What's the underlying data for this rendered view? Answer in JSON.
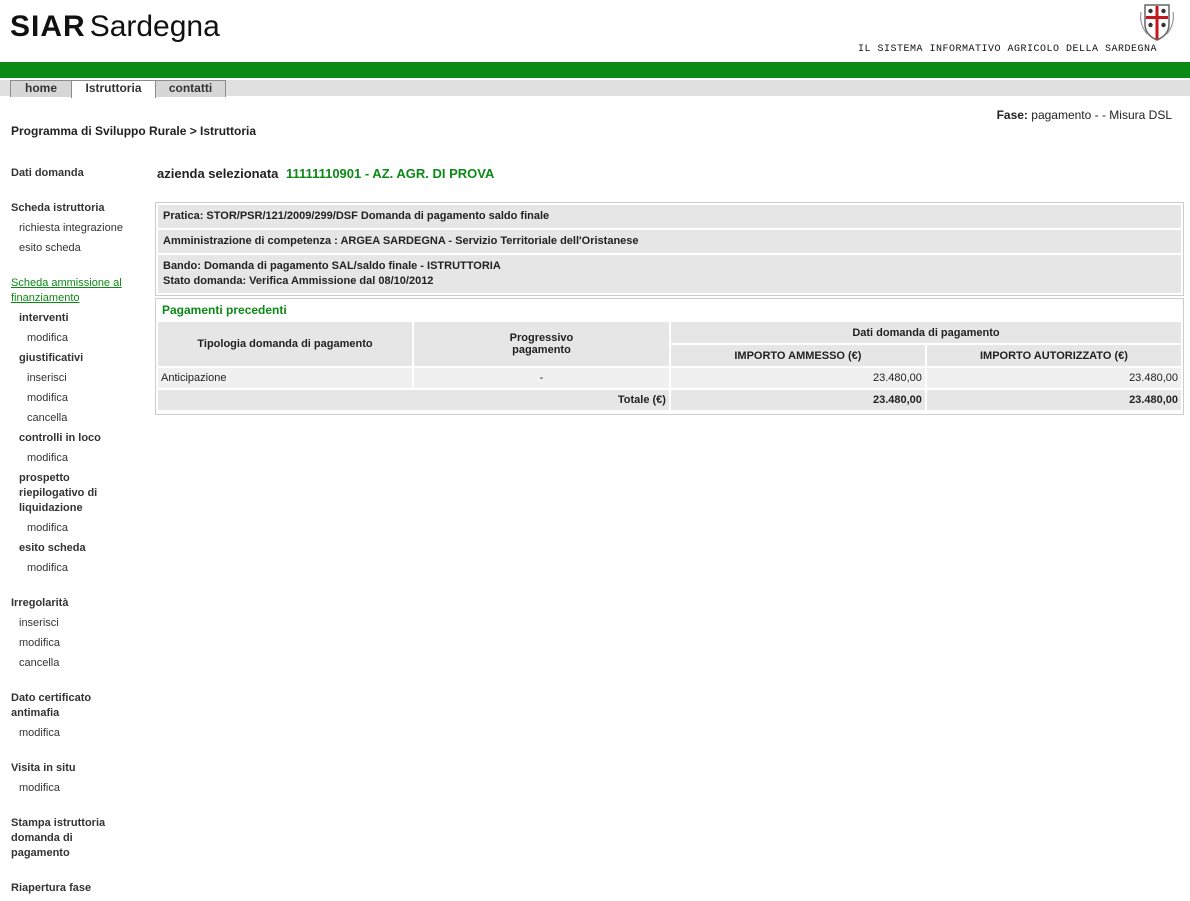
{
  "header": {
    "logo_bold": "SIAR",
    "logo_light": "Sardegna",
    "emblem": "regione-sardegna-coat-of-arms-icon",
    "tagline": "IL SISTEMA INFORMATIVO AGRICOLO DELLA SARDEGNA"
  },
  "colors": {
    "brand_green": "#0b8a16",
    "panel_grey": "#e6e6e6"
  },
  "tabs": [
    {
      "label": "home"
    },
    {
      "label": "Istruttoria",
      "active": true
    },
    {
      "label": "contatti"
    }
  ],
  "fase": {
    "label": "Fase:",
    "value": "pagamento - - Misura DSL"
  },
  "breadcrumb": "Programma di Sviluppo Rurale > Istruttoria",
  "sidebar": {
    "items": [
      {
        "label": "Dati domanda"
      },
      {
        "label": "Scheda istruttoria"
      },
      {
        "label": "richiesta integrazione"
      },
      {
        "label": "esito scheda"
      },
      {
        "label": "Scheda ammissione al finanziamento"
      },
      {
        "label": "interventi"
      },
      {
        "label": "modifica"
      },
      {
        "label": "giustificativi"
      },
      {
        "label": "inserisci"
      },
      {
        "label": "modifica"
      },
      {
        "label": "cancella"
      },
      {
        "label": "controlli in loco"
      },
      {
        "label": "modifica"
      },
      {
        "label": "prospetto riepilogativo di liquidazione"
      },
      {
        "label": "modifica"
      },
      {
        "label": "esito scheda"
      },
      {
        "label": "modifica"
      },
      {
        "label": "Irregolarità"
      },
      {
        "label": "inserisci"
      },
      {
        "label": "modifica"
      },
      {
        "label": "cancella"
      },
      {
        "label": "Dato certificato antimafia"
      },
      {
        "label": "modifica"
      },
      {
        "label": "Visita in situ"
      },
      {
        "label": "modifica"
      },
      {
        "label": "Stampa istruttoria domanda di pagamento"
      },
      {
        "label": "Riapertura fase"
      }
    ]
  },
  "main": {
    "azienda_label": "azienda selezionata",
    "azienda_value": "11111110901 - AZ. AGR. DI PROVA",
    "info": {
      "pratica": "Pratica: STOR/PSR/121/2009/299/DSF Domanda di pagamento saldo finale",
      "amministrazione": "Amministrazione di competenza : ARGEA SARDEGNA - Servizio Territoriale dell'Oristanese",
      "bando": "Bando: Domanda di pagamento SAL/saldo finale - ISTRUTTORIA",
      "stato": "Stato domanda: Verifica Ammissione dal 08/10/2012"
    },
    "pagamenti": {
      "title": "Pagamenti precedenti",
      "col_tipologia": "Tipologia domanda di pagamento",
      "col_progressivo": "Progressivo pagamento",
      "col_group": "Dati domanda di pagamento",
      "col_ammesso": "IMPORTO AMMESSO (€)",
      "col_autorizzato": "IMPORTO AUTORIZZATO (€)",
      "rows": [
        {
          "tipologia": "Anticipazione",
          "progressivo": "-",
          "ammesso": "23.480,00",
          "autorizzato": "23.480,00"
        }
      ],
      "totale_label": "Totale (€)",
      "totale_ammesso": "23.480,00",
      "totale_autorizzato": "23.480,00"
    }
  }
}
